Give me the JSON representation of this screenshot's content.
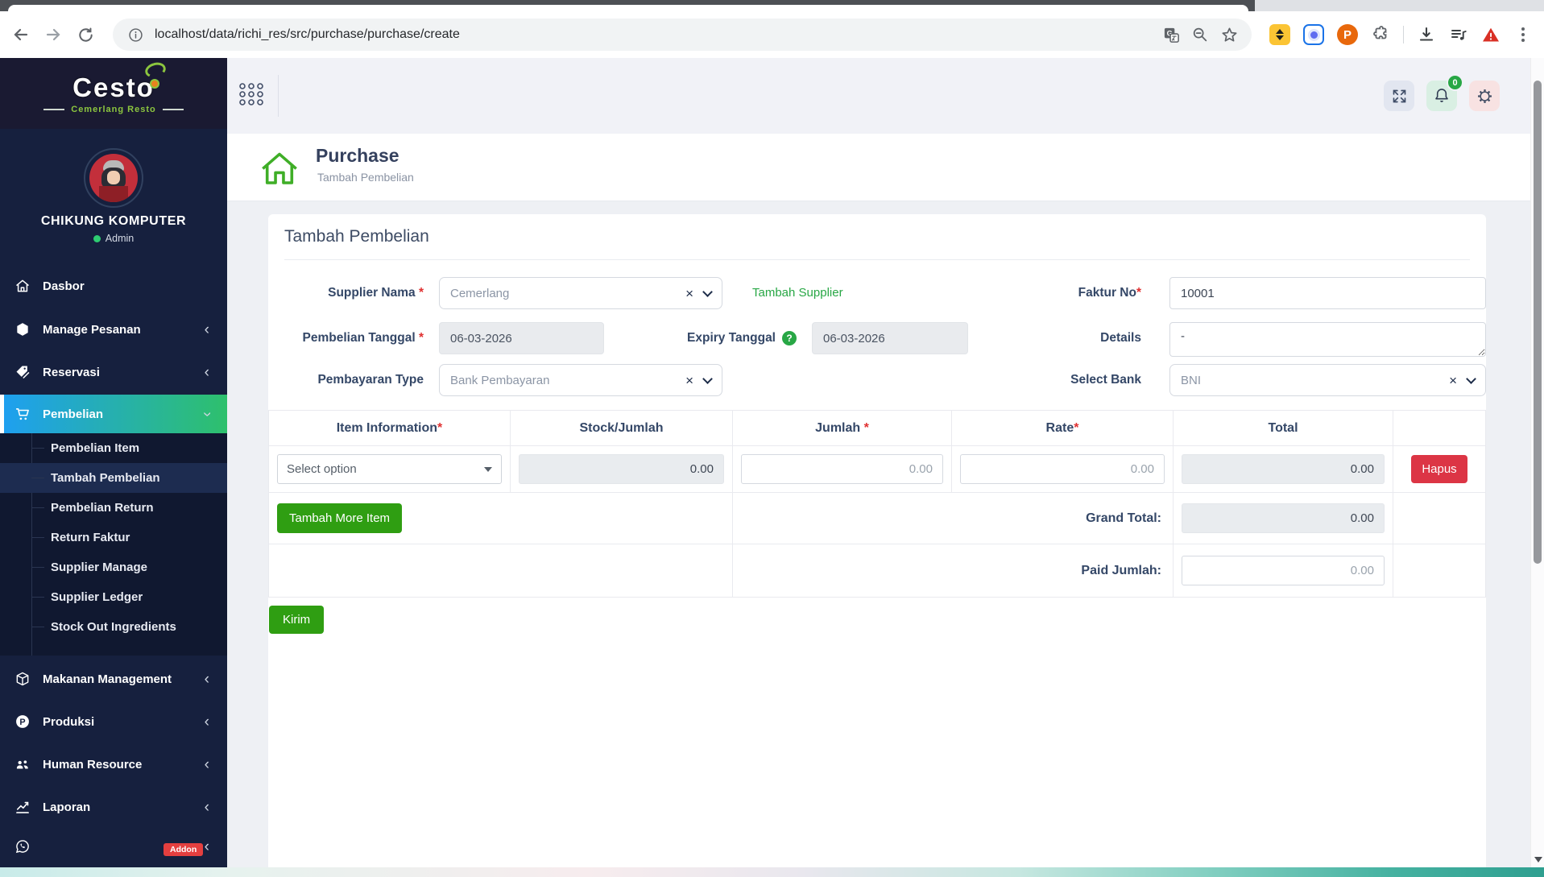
{
  "browser": {
    "url": "localhost/data/richi_res/src/purchase/purchase/create"
  },
  "brand": {
    "name": "Cesto",
    "tagline": "Cemerlang Resto"
  },
  "user": {
    "name": "CHIKUNG KOMPUTER",
    "role": "Admin"
  },
  "nav": {
    "items": [
      {
        "label": "Dasbor"
      },
      {
        "label": "Manage Pesanan"
      },
      {
        "label": "Reservasi"
      },
      {
        "label": "Pembelian"
      },
      {
        "label": "Makanan Management"
      },
      {
        "label": "Produksi"
      },
      {
        "label": "Human Resource"
      },
      {
        "label": "Laporan"
      }
    ],
    "submenu": [
      "Pembelian Item",
      "Tambah Pembelian",
      "Pembelian Return",
      "Return Faktur",
      "Supplier Manage",
      "Supplier Ledger",
      "Stock Out Ingredients"
    ],
    "addon_badge": "Addon"
  },
  "appbar": {
    "notification_count": "0"
  },
  "page_header": {
    "title": "Purchase",
    "subtitle": "Tambah Pembelian"
  },
  "form": {
    "card_title": "Tambah Pembelian",
    "required_marker": "*",
    "supplier": {
      "label": "Supplier Nama",
      "value": "Cemerlang"
    },
    "tambah_supplier_link": "Tambah Supplier",
    "faktur": {
      "label": "Faktur No",
      "value": "10001"
    },
    "tanggal": {
      "label": "Pembelian Tanggal",
      "value": "06-03-2026"
    },
    "expiry": {
      "label": "Expiry Tanggal",
      "value": "06-03-2026",
      "help": "?"
    },
    "details": {
      "label": "Details",
      "value": "-"
    },
    "pembayaran": {
      "label": "Pembayaran Type",
      "value": "Bank Pembayaran"
    },
    "bank": {
      "label": "Select Bank",
      "value": "BNI"
    }
  },
  "items_table": {
    "headers": {
      "item": "Item Information",
      "stock": "Stock/Jumlah",
      "jumlah": "Jumlah",
      "rate": "Rate",
      "total": "Total"
    },
    "row": {
      "item_placeholder": "Select option",
      "stock": "0.00",
      "jumlah": "0.00",
      "rate": "0.00",
      "total": "0.00",
      "delete_label": "Hapus"
    },
    "add_item_label": "Tambah More Item",
    "grand_total": {
      "label": "Grand Total:",
      "value": "0.00"
    },
    "paid": {
      "label": "Paid Jumlah:",
      "value": "0.00"
    }
  },
  "actions": {
    "submit_label": "Kirim"
  },
  "colors": {
    "accent_blue": "#1e9ff2",
    "accent_green": "#2ec06c",
    "button_green": "#2f9e12",
    "danger": "#dc3545",
    "link_green": "#28a745"
  }
}
